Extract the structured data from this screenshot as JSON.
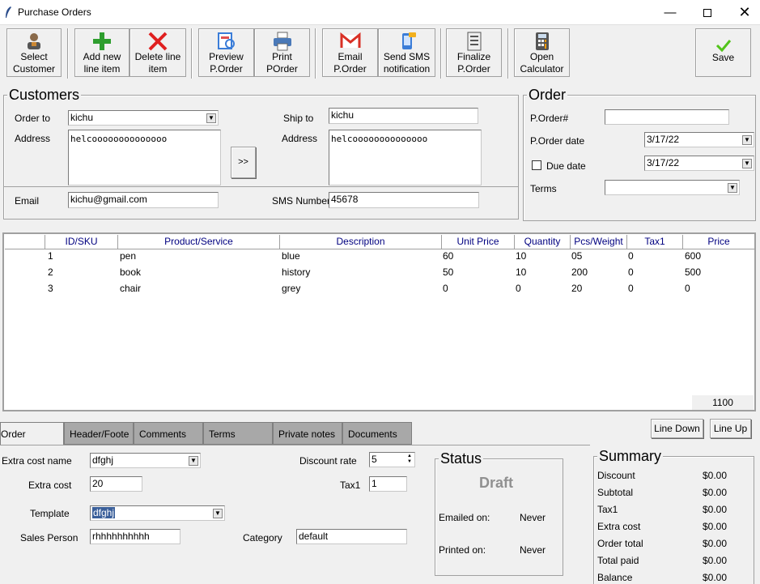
{
  "window": {
    "title": "Purchase Orders"
  },
  "toolbar": {
    "select_customer": [
      "Select",
      "Customer"
    ],
    "add_line": [
      "Add new",
      "line item"
    ],
    "delete_line": [
      "Delete line",
      "item"
    ],
    "preview": [
      "Preview",
      "P.Order"
    ],
    "print": [
      "Print",
      "POrder"
    ],
    "email": [
      "Email",
      "P.Order"
    ],
    "sms": [
      "Send SMS",
      "notification"
    ],
    "finalize": [
      "Finalize",
      "P.Order"
    ],
    "calculator": [
      "Open",
      "Calculator"
    ],
    "save": "Save"
  },
  "customers": {
    "title": "Customers",
    "order_to_label": "Order to",
    "order_to_value": "kichu",
    "address_label": "Address",
    "address_value": "helcoooooooooooooo",
    "copy_button": ">>",
    "ship_to_label": "Ship to",
    "ship_to_value": "kichu",
    "ship_address_label": "Address",
    "ship_address_value": "helcoooooooooooooo",
    "email_label": "Email",
    "email_value": "kichu@gmail.com",
    "sms_label": "SMS Number",
    "sms_value": "45678"
  },
  "order": {
    "title": "Order",
    "porder_no_label": "P.Order#",
    "porder_no_value": "",
    "porder_date_label": "P.Order date",
    "porder_date_value": "3/17/22",
    "due_date_label": "Due date",
    "due_date_value": "3/17/22",
    "terms_label": "Terms",
    "terms_value": ""
  },
  "table": {
    "columns": [
      "",
      "ID/SKU",
      "Product/Service",
      "Description",
      "Unit Price",
      "Quantity",
      "Pcs/Weight",
      "Tax1",
      "Price"
    ],
    "rows": [
      [
        "1",
        "pen",
        "blue",
        "60",
        "10",
        "05",
        "0",
        "600"
      ],
      [
        "2",
        "book",
        "history",
        "50",
        "10",
        "200",
        "0",
        "500"
      ],
      [
        "3",
        "chair",
        "grey",
        "0",
        "0",
        "20",
        "0",
        "0"
      ]
    ],
    "total": "1100"
  },
  "line_buttons": {
    "down": "Line Down",
    "up": "Line Up"
  },
  "tabs": [
    "Order",
    "Header/Foote",
    "Comments",
    "Terms",
    "Private notes",
    "Documents"
  ],
  "order_tab": {
    "extra_cost_name_label": "Extra cost name",
    "extra_cost_name_value": "dfghj",
    "extra_cost_label": "Extra cost",
    "extra_cost_value": "20",
    "template_label": "Template",
    "template_value": "dfghj",
    "sales_person_label": "Sales Person",
    "sales_person_value": "rhhhhhhhhhh",
    "discount_rate_label": "Discount rate",
    "discount_rate_value": "5",
    "tax1_label": "Tax1",
    "tax1_value": "1",
    "category_label": "Category",
    "category_value": "default"
  },
  "status": {
    "title": "Status",
    "state": "Draft",
    "emailed_label": "Emailed on:",
    "emailed_value": "Never",
    "printed_label": "Printed on:",
    "printed_value": "Never"
  },
  "summary": {
    "title": "Summary",
    "rows": [
      [
        "Discount",
        "$0.00"
      ],
      [
        "Subtotal",
        "$0.00"
      ],
      [
        "Tax1",
        "$0.00"
      ],
      [
        "Extra cost",
        "$0.00"
      ],
      [
        "Order total",
        "$0.00"
      ],
      [
        "Total paid",
        "$0.00"
      ],
      [
        "Balance",
        "$0.00"
      ]
    ]
  },
  "colors": {
    "header_text": "#000080",
    "save_check": "#52c41a",
    "add_plus": "#2e9e2e",
    "delete_x": "#e02020",
    "draft_text": "#909090",
    "selection": "#3a5f9a"
  }
}
